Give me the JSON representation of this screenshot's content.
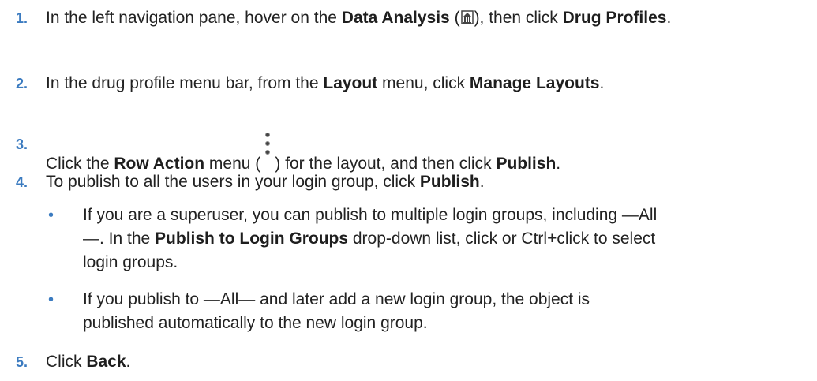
{
  "steps": [
    {
      "number": "1.",
      "text_a": "In the left navigation pane, hover on the ",
      "bold_a": "Data Analysis",
      "text_b": " (",
      "icon": "data-analysis-icon",
      "text_c": "), then click ",
      "bold_b": "Drug Profiles",
      "text_d": "."
    },
    {
      "number": "2.",
      "text_a": "In the drug profile menu bar, from the ",
      "bold_a": "Layout",
      "text_b": " menu, click ",
      "bold_b": "Manage Layouts",
      "text_c": "."
    },
    {
      "number": "3.",
      "text_a": "Click the ",
      "bold_a": "Row Action",
      "text_b": " menu (",
      "icon": "row-action-icon",
      "text_c": ") for the layout, and then click ",
      "bold_b": "Publish",
      "text_d": "."
    },
    {
      "number": "4.",
      "text_a": "To publish to all the users in your login group, click ",
      "bold_a": "Publish",
      "text_b": "."
    },
    {
      "number": "5.",
      "text_a": "Click ",
      "bold_a": "Back",
      "text_b": "."
    }
  ],
  "bullets": [
    {
      "line1": "If you are a superuser, you can publish to multiple login groups, including —All",
      "line2_a": "—. In the ",
      "line2_bold": "Publish to Login Groups",
      "line2_b": " drop-down list, click or Ctrl+click to select",
      "line3": "login groups."
    },
    {
      "line1": "If you publish to —All— and later add a new login group, the object is",
      "line2": "published automatically to the new login group."
    }
  ],
  "bullet_glyph": "•",
  "colors": {
    "accent": "#3b7bc0",
    "text": "#222222"
  }
}
